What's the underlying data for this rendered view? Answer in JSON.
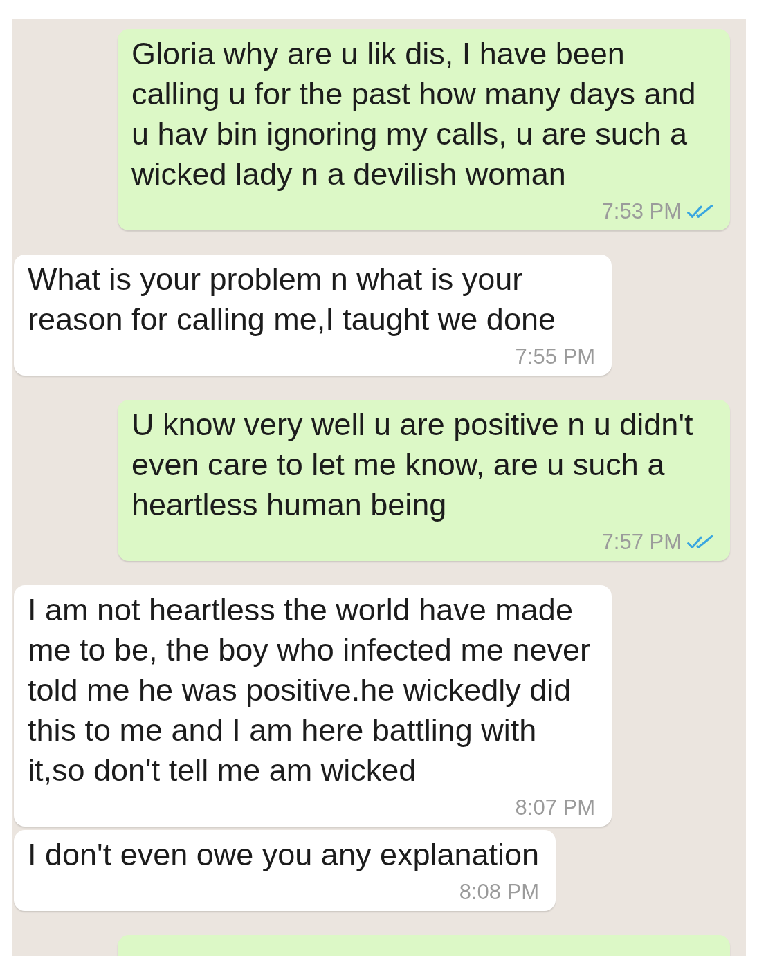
{
  "messages": [
    {
      "kind": "outgoing",
      "text": "Gloria why are u lik dis, I have been calling u for the past how many days and u hav bin ignoring my calls, u are such a wicked lady n a devilish woman",
      "time": "7:53 PM",
      "read": true
    },
    {
      "kind": "incoming",
      "text": "What is your problem n what is your reason for calling me,I taught we done",
      "time": "7:55 PM"
    },
    {
      "kind": "outgoing",
      "text": "U know very well u are positive n u didn't even care to let me know, are u such a heartless human being",
      "time": "7:57 PM",
      "read": true
    },
    {
      "kind": "incoming",
      "text": "I am not heartless the world have made me to be, the boy who infected me never told me he was positive.he wickedly did this to me and I am here battling with it,so don't tell me am wicked",
      "time": "8:07 PM"
    },
    {
      "kind": "incoming",
      "text": "I don't even owe you any explanation",
      "time": "8:08 PM"
    },
    {
      "kind": "outgoing"
    }
  ]
}
